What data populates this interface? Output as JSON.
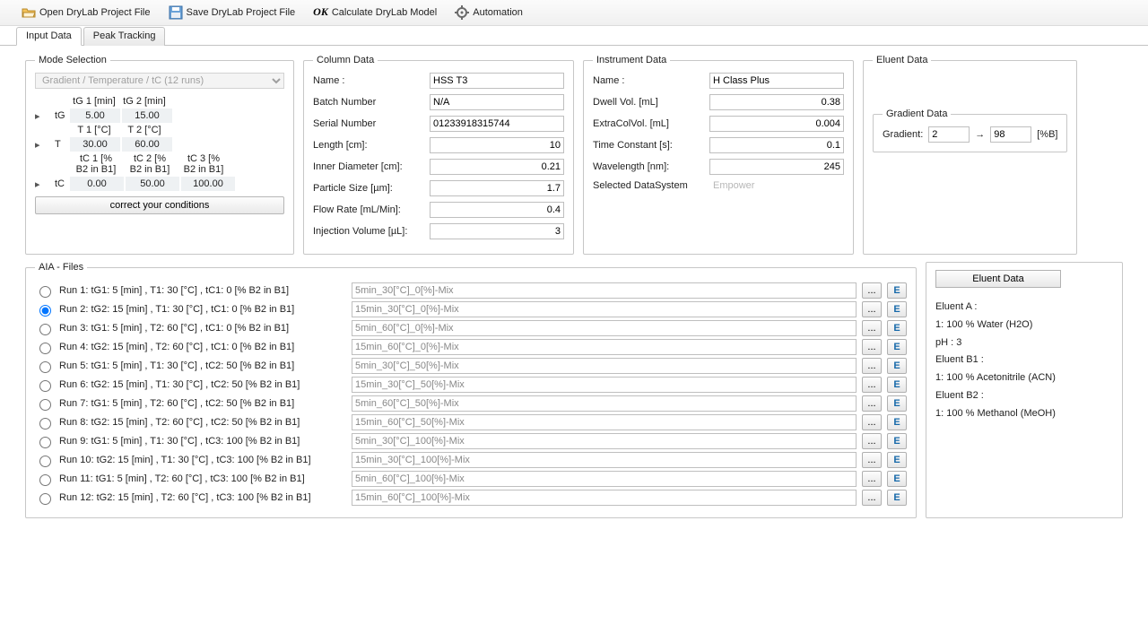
{
  "toolbar": {
    "open": "Open DryLab Project File",
    "save": "Save DryLab Project File",
    "calc": "Calculate DryLab Model",
    "auto": "Automation"
  },
  "tabs": {
    "input": "Input Data",
    "peak": "Peak Tracking"
  },
  "mode": {
    "legend": "Mode Selection",
    "selected": "Gradient / Temperature / tC (12 runs)",
    "tg_head1": "tG 1 [min]",
    "tg_head2": "tG 2 [min]",
    "tg_lab": "tG",
    "tg_v1": "5.00",
    "tg_v2": "15.00",
    "t_head1": "T 1 [°C]",
    "t_head2": "T 2 [°C]",
    "t_lab": "T",
    "t_v1": "30.00",
    "t_v2": "60.00",
    "tc_head1": "tC 1 [% B2 in B1]",
    "tc_head2": "tC 2 [% B2 in B1]",
    "tc_head3": "tC 3 [% B2 in B1]",
    "tc_lab": "tC",
    "tc_v1": "0.00",
    "tc_v2": "50.00",
    "tc_v3": "100.00",
    "btn": "correct your conditions"
  },
  "column": {
    "legend": "Column Data",
    "name_l": "Name :",
    "name": "HSS T3",
    "batch_l": "Batch Number",
    "batch": "N/A",
    "serial_l": "Serial Number",
    "serial": "01233918315744",
    "length_l": "Length [cm]:",
    "length": "10",
    "id_l": "Inner Diameter [cm]:",
    "id": "0.21",
    "ps_l": "Particle Size [µm]:",
    "ps": "1.7",
    "fr_l": "Flow Rate [mL/Min]:",
    "fr": "0.4",
    "iv_l": "Injection Volume [µL]:",
    "iv": "3"
  },
  "instrument": {
    "legend": "Instrument Data",
    "name_l": "Name :",
    "name": "H Class Plus",
    "dwell_l": "Dwell Vol. [mL]",
    "dwell": "0.38",
    "extra_l": "ExtraColVol. [mL]",
    "extra": "0.004",
    "tc_l": "Time Constant [s]:",
    "tc": "0.1",
    "wl_l": "Wavelength [nm]:",
    "wl": "245",
    "ds_l": "Selected DataSystem",
    "ds": "Empower"
  },
  "eluent": {
    "legend": "Eluent Data",
    "grad_legend": "Gradient Data",
    "grad_l": "Gradient:",
    "grad_from": "2",
    "arrow": "→",
    "grad_to": "98",
    "grad_unit": "[%B]",
    "btn": "Eluent Data",
    "a_l": "Eluent A :",
    "a_v": "1: 100 % Water (H2O)",
    "ph": "pH : 3",
    "b1_l": "Eluent B1 :",
    "b1_v": "1: 100 % Acetonitrile (ACN)",
    "b2_l": "Eluent B2 :",
    "b2_v": "1: 100 % Methanol (MeOH)"
  },
  "aia": {
    "legend": "AIA - Files",
    "ellipsis": "...",
    "e": "E",
    "runs": [
      {
        "sel": false,
        "label": "Run 1: tG1:  5 [min] ,   T1:  30 [°C] ,   tC1:  0 [% B2 in B1]",
        "file": "5min_30[°C]_0[%]-Mix"
      },
      {
        "sel": true,
        "label": "Run 2: tG2:  15 [min] ,   T1:  30 [°C] ,   tC1:  0 [% B2 in B1]",
        "file": "15min_30[°C]_0[%]-Mix"
      },
      {
        "sel": false,
        "label": "Run 3: tG1:  5 [min] ,   T2:  60 [°C] ,   tC1:  0 [% B2 in B1]",
        "file": "5min_60[°C]_0[%]-Mix"
      },
      {
        "sel": false,
        "label": "Run 4: tG2:  15 [min] ,   T2:  60 [°C] ,   tC1:  0 [% B2 in B1]",
        "file": "15min_60[°C]_0[%]-Mix"
      },
      {
        "sel": false,
        "label": "Run 5: tG1:  5 [min] ,   T1:  30 [°C] ,   tC2:  50 [% B2 in B1]",
        "file": "5min_30[°C]_50[%]-Mix"
      },
      {
        "sel": false,
        "label": "Run 6: tG2:  15 [min] ,   T1:  30 [°C] ,   tC2:  50 [% B2 in B1]",
        "file": "15min_30[°C]_50[%]-Mix"
      },
      {
        "sel": false,
        "label": "Run 7: tG1:  5 [min] ,   T2:  60 [°C] ,   tC2:  50 [% B2 in B1]",
        "file": "5min_60[°C]_50[%]-Mix"
      },
      {
        "sel": false,
        "label": "Run 8: tG2:  15 [min] ,   T2:  60 [°C] ,   tC2:  50 [% B2 in B1]",
        "file": "15min_60[°C]_50[%]-Mix"
      },
      {
        "sel": false,
        "label": "Run 9: tG1:  5 [min] ,   T1:  30 [°C] ,   tC3:  100 [% B2 in B1]",
        "file": "5min_30[°C]_100[%]-Mix"
      },
      {
        "sel": false,
        "label": "Run 10: tG2:  15 [min] ,   T1:  30 [°C] ,   tC3:  100 [% B2 in B1]",
        "file": "15min_30[°C]_100[%]-Mix"
      },
      {
        "sel": false,
        "label": "Run 11: tG1:  5 [min] ,   T2:  60 [°C] ,   tC3:  100 [% B2 in B1]",
        "file": "5min_60[°C]_100[%]-Mix"
      },
      {
        "sel": false,
        "label": "Run 12: tG2:  15 [min] ,   T2:  60 [°C] ,   tC3:  100 [% B2 in B1]",
        "file": "15min_60[°C]_100[%]-Mix"
      }
    ]
  }
}
